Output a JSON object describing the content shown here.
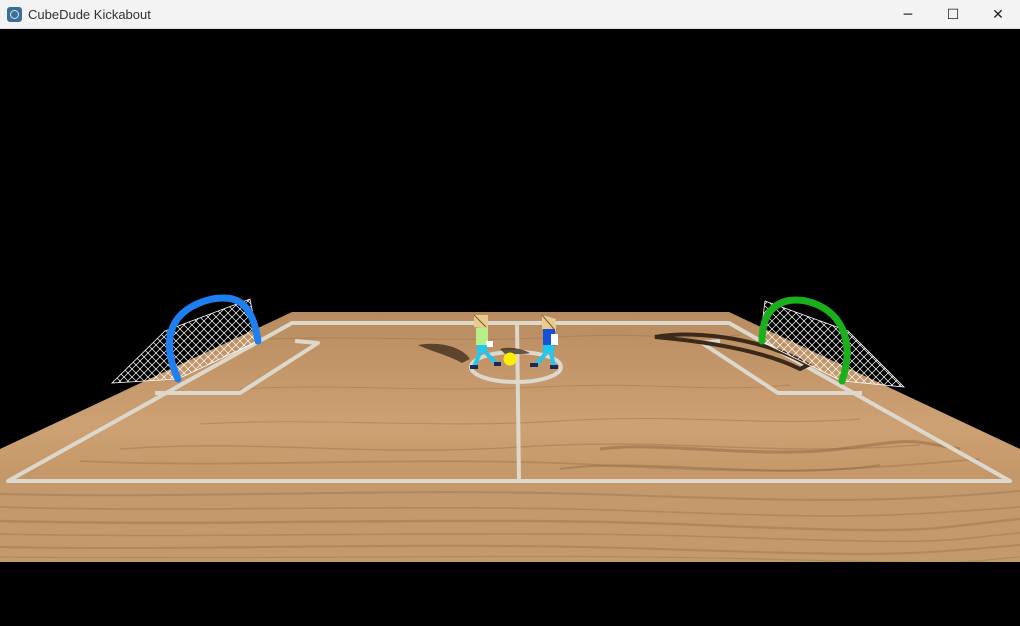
{
  "window": {
    "title": "CubeDude Kickabout",
    "icon": "game-engine-icon",
    "controls": {
      "minimize": "─",
      "maximize": "☐",
      "close": "✕"
    }
  },
  "scene": {
    "background_color": "#000000",
    "pitch_color": "#c79b6d",
    "line_color": "#dcd8cc",
    "ball_color": "#ffee00",
    "left_goal_color": "#1e7ff0",
    "right_goal_color": "#19b01b",
    "player_left": {
      "shirt_color": "#b7f08a",
      "shorts_color": "#1ec8f0"
    },
    "player_right": {
      "shirt_color": "#1450d8",
      "shorts_color": "#1ec8f0"
    }
  }
}
